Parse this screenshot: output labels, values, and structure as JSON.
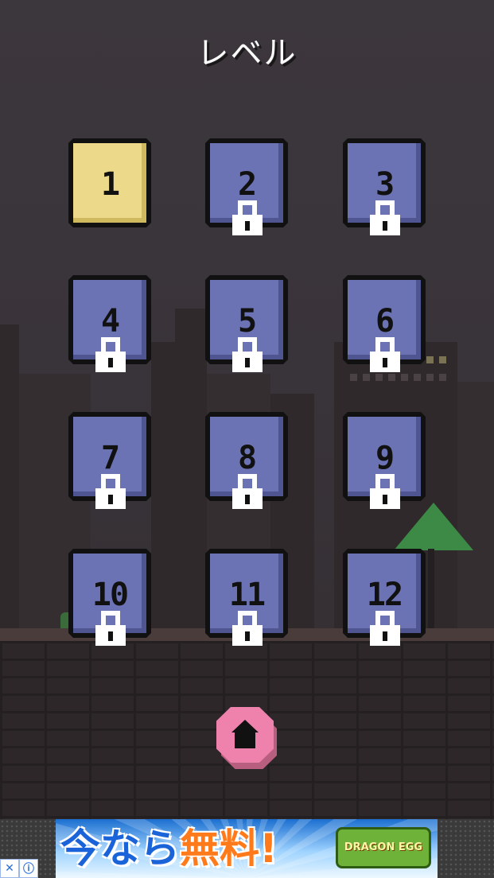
{
  "title": "レベル",
  "levels": [
    {
      "label": "1",
      "locked": false
    },
    {
      "label": "2",
      "locked": true
    },
    {
      "label": "3",
      "locked": true
    },
    {
      "label": "4",
      "locked": true
    },
    {
      "label": "5",
      "locked": true
    },
    {
      "label": "6",
      "locked": true
    },
    {
      "label": "7",
      "locked": true
    },
    {
      "label": "8",
      "locked": true
    },
    {
      "label": "9",
      "locked": true
    },
    {
      "label": "10",
      "locked": true
    },
    {
      "label": "11",
      "locked": true
    },
    {
      "label": "12",
      "locked": true
    }
  ],
  "home_button": {
    "icon": "home-icon"
  },
  "ad": {
    "headline_a": "今なら",
    "headline_b": "無料!",
    "logo_text": "DRAGON EGG",
    "close_icon": "close-icon",
    "info_icon": "info-icon"
  },
  "colors": {
    "unlocked_tile": "#ecd98a",
    "locked_tile": "#6b73b4",
    "home_button": "#ef82ad",
    "background": "#38333a"
  }
}
